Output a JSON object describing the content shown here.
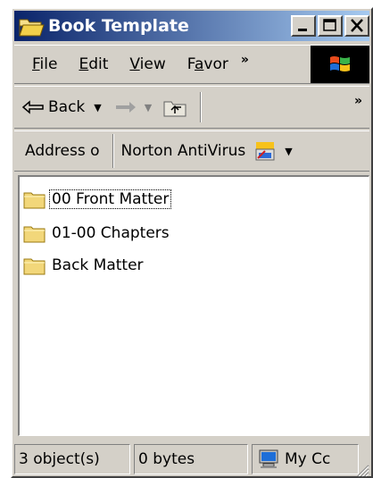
{
  "window": {
    "title": "Book Template"
  },
  "menubar": {
    "items": [
      {
        "label": "File",
        "key": "F"
      },
      {
        "label": "Edit",
        "key": "E"
      },
      {
        "label": "View",
        "key": "V"
      },
      {
        "label": "Favor",
        "key": "a"
      }
    ],
    "overflow": "»"
  },
  "toolbar": {
    "back_label": "Back",
    "overflow": "»"
  },
  "addressbar": {
    "address_label": "Address o",
    "norton_label": "Norton AntiVirus"
  },
  "files": [
    {
      "name": "00 Front Matter",
      "icon": "folder-icon",
      "focused": true
    },
    {
      "name": "01-00 Chapters",
      "icon": "folder-icon",
      "focused": false
    },
    {
      "name": "Back Matter",
      "icon": "folder-icon",
      "focused": false
    }
  ],
  "statusbar": {
    "objects": "3 object(s)",
    "size": "0 bytes",
    "zone": "My Cc"
  },
  "colors": {
    "titlebar_start": "#0a246a",
    "titlebar_end": "#a6caf0",
    "face": "#d4d0c8",
    "folder": "#f2d77a"
  }
}
